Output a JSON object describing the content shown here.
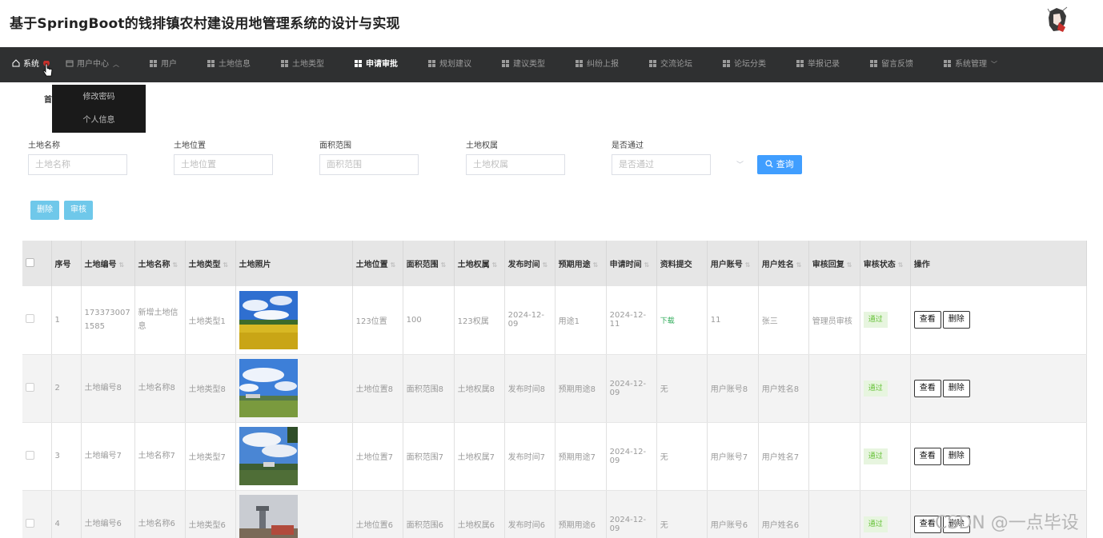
{
  "header": {
    "title": "基于SpringBoot的钱排镇农村建设用地管理系统的设计与实现"
  },
  "nav": {
    "items": [
      {
        "label": "系统",
        "icon": "home-icon"
      },
      {
        "label": "用户中心",
        "icon": "calendar-icon"
      },
      {
        "label": "用户",
        "icon": "grid-icon"
      },
      {
        "label": "土地信息",
        "icon": "clipboard-icon"
      },
      {
        "label": "土地类型",
        "icon": "grid-icon"
      },
      {
        "label": "申请审批",
        "icon": "grid-icon"
      },
      {
        "label": "规划建议",
        "icon": "chat-icon"
      },
      {
        "label": "建议类型",
        "icon": "grid-icon"
      },
      {
        "label": "纠纷上报",
        "icon": "grid-icon"
      },
      {
        "label": "交流论坛",
        "icon": "user-icon"
      },
      {
        "label": "论坛分类",
        "icon": "clipboard-icon"
      },
      {
        "label": "举报记录",
        "icon": "grid-icon"
      },
      {
        "label": "留言反馈",
        "icon": "grid-icon"
      },
      {
        "label": "系统管理",
        "icon": "grid-icon"
      }
    ],
    "active": "申请审批",
    "dropdown": [
      "修改密码",
      "个人信息"
    ]
  },
  "breadcrumb_fragment": "首",
  "filters": [
    {
      "label": "土地名称",
      "placeholder": "土地名称"
    },
    {
      "label": "土地位置",
      "placeholder": "土地位置"
    },
    {
      "label": "面积范围",
      "placeholder": "面积范围"
    },
    {
      "label": "土地权属",
      "placeholder": "土地权属"
    },
    {
      "label": "是否通过",
      "placeholder": "是否通过"
    }
  ],
  "buttons": {
    "search": "查询",
    "delete": "删除",
    "review": "审核"
  },
  "table": {
    "columns": [
      "序号",
      "土地编号",
      "土地名称",
      "土地类型",
      "土地照片",
      "土地位置",
      "面积范围",
      "土地权属",
      "发布时间",
      "预期用途",
      "申请时间",
      "资料提交",
      "用户账号",
      "用户姓名",
      "审核回复",
      "审核状态",
      "操作"
    ],
    "rows": [
      {
        "no": "1",
        "code": "1733730071585",
        "name": "新增土地信息",
        "type": "土地类型1",
        "photo": "sky-field-yellow",
        "location": "123位置",
        "area": "100",
        "ownership": "123权属",
        "publish_time": "2024-12-09",
        "purpose": "用途1",
        "apply_time": "2024-12-11",
        "material": "下载",
        "material_is_link": true,
        "account": "11",
        "username": "张三",
        "reply": "管理员审核",
        "status": "通过"
      },
      {
        "no": "2",
        "code": "土地编号8",
        "name": "土地名称8",
        "type": "土地类型8",
        "photo": "sky-field-green",
        "location": "土地位置8",
        "area": "面积范围8",
        "ownership": "土地权属8",
        "publish_time": "发布时间8",
        "purpose": "预期用途8",
        "apply_time": "2024-12-09",
        "material": "无",
        "material_is_link": false,
        "account": "用户账号8",
        "username": "用户姓名8",
        "reply": "",
        "status": "通过"
      },
      {
        "no": "3",
        "code": "土地编号7",
        "name": "土地名称7",
        "type": "土地类型7",
        "photo": "sky-village",
        "location": "土地位置7",
        "area": "面积范围7",
        "ownership": "土地权属7",
        "publish_time": "发布时间7",
        "purpose": "预期用途7",
        "apply_time": "2024-12-09",
        "material": "无",
        "material_is_link": false,
        "account": "用户账号7",
        "username": "用户姓名7",
        "reply": "",
        "status": "通过"
      },
      {
        "no": "4",
        "code": "土地编号6",
        "name": "土地名称6",
        "type": "土地类型6",
        "photo": "tower-village",
        "location": "土地位置6",
        "area": "面积范围6",
        "ownership": "土地权属6",
        "publish_time": "发布时间6",
        "purpose": "预期用途6",
        "apply_time": "2024-12-09",
        "material": "无",
        "material_is_link": false,
        "account": "用户账号6",
        "username": "用户姓名6",
        "reply": "",
        "status": "通过"
      }
    ],
    "row_actions": [
      "查看",
      "删除"
    ]
  },
  "watermark": "CSDN @一点毕设"
}
